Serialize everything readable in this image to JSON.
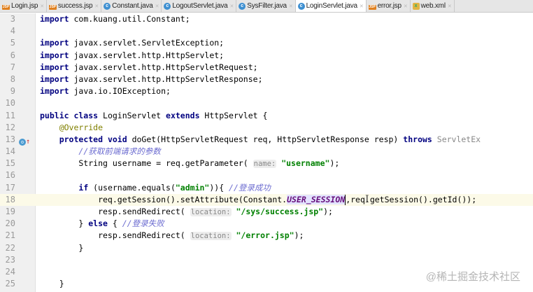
{
  "tabs": [
    {
      "label": "Login.jsp",
      "icon": "jsp"
    },
    {
      "label": "success.jsp",
      "icon": "jsp"
    },
    {
      "label": "Constant.java",
      "icon": "java"
    },
    {
      "label": "LogoutServlet.java",
      "icon": "java"
    },
    {
      "label": "SysFilter.java",
      "icon": "java"
    },
    {
      "label": "LoginServlet.java",
      "icon": "java",
      "active": true
    },
    {
      "label": "error.jsp",
      "icon": "jsp"
    },
    {
      "label": "web.xml",
      "icon": "xml"
    }
  ],
  "lines": [
    {
      "n": "3",
      "t": [
        [
          "kw",
          "import"
        ],
        [
          "",
          "com.kuang.util.Constant;"
        ]
      ]
    },
    {
      "n": "4",
      "t": []
    },
    {
      "n": "5",
      "t": [
        [
          "kw",
          "import"
        ],
        [
          "",
          "javax.servlet.ServletException;"
        ]
      ]
    },
    {
      "n": "6",
      "t": [
        [
          "kw",
          "import"
        ],
        [
          "",
          "javax.servlet.http.HttpServlet;"
        ]
      ]
    },
    {
      "n": "7",
      "t": [
        [
          "kw",
          "import"
        ],
        [
          "",
          "javax.servlet.http.HttpServletRequest;"
        ]
      ]
    },
    {
      "n": "8",
      "t": [
        [
          "kw",
          "import"
        ],
        [
          "",
          "javax.servlet.http.HttpServletResponse;"
        ]
      ]
    },
    {
      "n": "9",
      "t": [
        [
          "kw",
          "import"
        ],
        [
          "",
          "java.io.IOException;"
        ]
      ]
    },
    {
      "n": "10",
      "t": []
    },
    {
      "n": "11",
      "t": [
        [
          "kw",
          "public class"
        ],
        [
          "",
          "LoginServlet"
        ],
        [
          "kw",
          "extends"
        ],
        [
          "",
          "HttpServlet {"
        ]
      ]
    },
    {
      "n": "12",
      "t": [
        [
          "",
          "    "
        ],
        [
          "ann",
          "@Override"
        ]
      ]
    },
    {
      "n": "13",
      "marker": true,
      "t": [
        [
          "",
          "    "
        ],
        [
          "kw",
          "protected void"
        ],
        [
          "",
          "doGet(HttpServletRequest req, HttpServletResponse resp)"
        ],
        [
          "kw",
          "throws"
        ],
        [
          "gray",
          "ServletEx"
        ]
      ]
    },
    {
      "n": "14",
      "t": [
        [
          "",
          "        "
        ],
        [
          "cm",
          "//获取前端请求的参数"
        ]
      ]
    },
    {
      "n": "15",
      "t": [
        [
          "",
          "        String username = req.getParameter( "
        ],
        [
          "hint",
          "name:"
        ],
        [
          "",
          " "
        ],
        [
          "str",
          "\"username\""
        ],
        [
          "",
          ");"
        ]
      ]
    },
    {
      "n": "16",
      "t": []
    },
    {
      "n": "17",
      "t": [
        [
          "",
          "        "
        ],
        [
          "kw",
          "if"
        ],
        [
          "",
          "(username.equals("
        ],
        [
          "str",
          "\"admin\""
        ],
        [
          "",
          ")){ "
        ],
        [
          "cm",
          "//登录成功"
        ]
      ]
    },
    {
      "n": "18",
      "cur": true,
      "t": [
        [
          "",
          "            req.getSession().setAttribute(Constant."
        ],
        [
          "cst",
          "USER_SESSION"
        ],
        [
          "caret",
          ""
        ],
        [
          "",
          ",req.getSession().getId());"
        ]
      ]
    },
    {
      "n": "19",
      "t": [
        [
          "",
          "            resp.sendRedirect( "
        ],
        [
          "hint",
          "location:"
        ],
        [
          "",
          " "
        ],
        [
          "str",
          "\"/sys/success.jsp\""
        ],
        [
          "",
          ");"
        ]
      ]
    },
    {
      "n": "20",
      "t": [
        [
          "",
          "        }"
        ],
        [
          "kw",
          "else"
        ],
        [
          "",
          "{ "
        ],
        [
          "cm",
          "//登录失败"
        ]
      ]
    },
    {
      "n": "21",
      "t": [
        [
          "",
          "            resp.sendRedirect( "
        ],
        [
          "hint",
          "location:"
        ],
        [
          "",
          " "
        ],
        [
          "str",
          "\"/error.jsp\""
        ],
        [
          "",
          ");"
        ]
      ]
    },
    {
      "n": "22",
      "t": [
        [
          "",
          "        }"
        ]
      ]
    },
    {
      "n": "23",
      "t": []
    },
    {
      "n": "24",
      "t": []
    },
    {
      "n": "25",
      "t": [
        [
          "",
          "    }"
        ]
      ]
    }
  ],
  "watermark": "@稀土掘金技术社区"
}
